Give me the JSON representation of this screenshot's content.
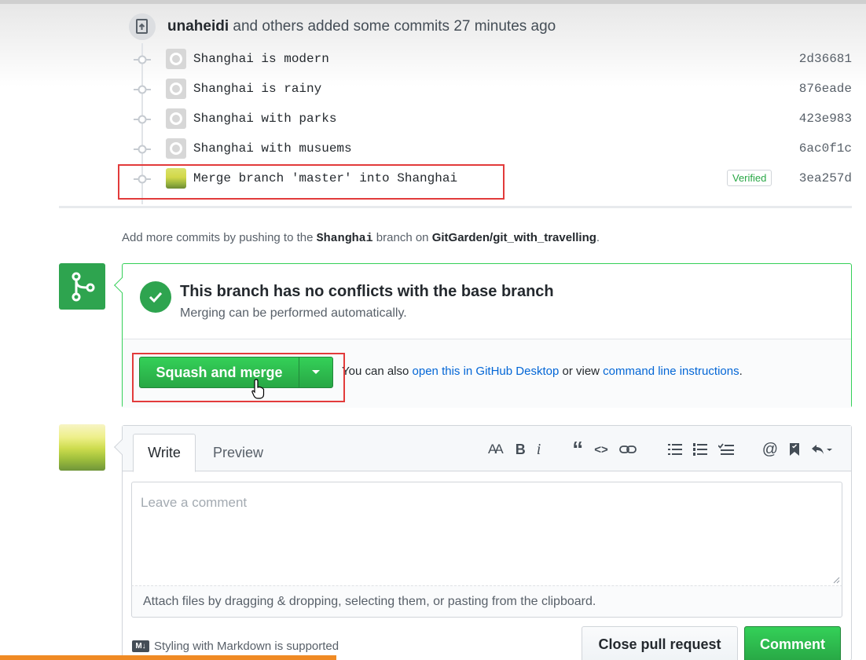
{
  "push": {
    "author": "unaheidi",
    "rest": " and others added some commits 27 minutes ago"
  },
  "commits": [
    {
      "message": "Shanghai is modern",
      "sha": "2d36681"
    },
    {
      "message": "Shanghai is rainy",
      "sha": "876eade"
    },
    {
      "message": "Shanghai with parks",
      "sha": "423e983"
    },
    {
      "message": "Shanghai with musuems",
      "sha": "6ac0f1c"
    },
    {
      "message": "Merge branch 'master' into Shanghai",
      "sha": "3ea257d",
      "badge": "Verified"
    }
  ],
  "add_more": {
    "prefix": "Add more commits by pushing to the ",
    "branch": "Shanghai",
    "middle": " branch on ",
    "repo": "GitGarden/git_with_travelling",
    "suffix": "."
  },
  "merge": {
    "title": "This branch has no conflicts with the base branch",
    "subtitle": "Merging can be performed automatically.",
    "button_label": "Squash and merge",
    "hint_prefix": "You can also ",
    "hint_link1": "open this in GitHub Desktop",
    "hint_middle": " or view ",
    "hint_link2": "command line instructions",
    "hint_suffix": "."
  },
  "comment": {
    "tab_write": "Write",
    "tab_preview": "Preview",
    "placeholder": "Leave a comment",
    "attach_text": "Attach files by dragging & dropping, selecting them, or pasting from the clipboard.",
    "markdown_note": "Styling with Markdown is supported",
    "markdown_badge": "M↓",
    "close_label": "Close pull request",
    "comment_label": "Comment"
  },
  "toolbar": {
    "header": "AA",
    "bold": "B",
    "italic": "i",
    "quote": "“",
    "code": "<>",
    "mention": "@"
  },
  "colors": {
    "green": "#2ea44f",
    "link": "#0366d6",
    "highlight": "#e23b3b",
    "accent_bar": "#f08a24"
  }
}
